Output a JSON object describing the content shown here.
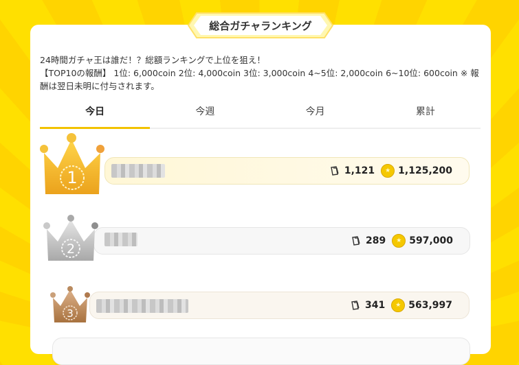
{
  "title": "総合ガチャランキング",
  "description": {
    "line1": "24時間ガチャ王は誰だ！？総額ランキングで上位を狙え！",
    "line2": "【TOP10の報酬】 1位: 6,000coin 2位: 4,000coin 3位: 3,000coin 4~5位: 2,000coin 6~10位: 600coin ※ 報",
    "line3": "酬は翌日未明に付与されます。"
  },
  "tabs": [
    {
      "label": "今日",
      "active": true
    },
    {
      "label": "今週",
      "active": false
    },
    {
      "label": "今月",
      "active": false
    },
    {
      "label": "累計",
      "active": false
    }
  ],
  "ranking": [
    {
      "rank": "1",
      "gacha_count": "1,121",
      "total_coin": "1,125,200"
    },
    {
      "rank": "2",
      "gacha_count": "289",
      "total_coin": "597,000"
    },
    {
      "rank": "3",
      "gacha_count": "341",
      "total_coin": "563,997"
    }
  ],
  "colors": {
    "gold": "#f2c200",
    "silver": "#bdbdbd",
    "bronze": "#b9855a",
    "background": "#ffdd00"
  },
  "icons": {
    "count": "ticket-icon",
    "coin": "coin-icon",
    "rank": "crown-icon"
  }
}
